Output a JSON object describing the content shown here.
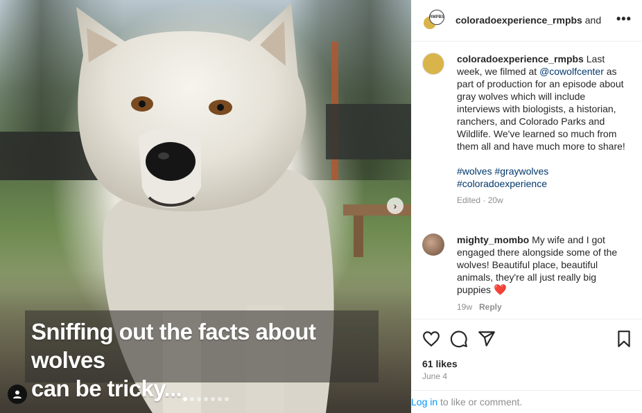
{
  "media": {
    "caption_line1": "Sniffing out the facts about wolves",
    "caption_line2": "can be tricky...",
    "next_icon": "chevron-right-icon",
    "carousel_dots": 7,
    "carousel_active_index": 0
  },
  "header": {
    "username": "coloradoexperience_rmpbs",
    "suffix": " and ",
    "avatar_badge": "RMPBS"
  },
  "post_caption": {
    "username": "coloradoexperience_rmpbs",
    "text_before_mention": " Last week, we filmed at ",
    "mention": "@cowolfcenter",
    "text_after_mention": " as part of production for an episode about gray wolves which will include interviews with biologists, a historian, ranchers, and Colorado Parks and Wildlife. We've learned so much from them all and have much more to share!",
    "hashtags": [
      "#wolves",
      "#graywolves",
      "#coloradoexperience"
    ],
    "meta": "Edited · 20w"
  },
  "comments": [
    {
      "username": "mighty_mombo",
      "text": " My wife and I got engaged there alongside some of the wolves! Beautiful place, beautiful animals, they're all just really big puppies ",
      "emoji": "❤️",
      "age": "19w",
      "reply_label": "Reply"
    }
  ],
  "actions": {
    "likes": "61 likes",
    "date": "June 4"
  },
  "login_bar": {
    "link": "Log in",
    "text": " to like or comment."
  },
  "colors": {
    "link": "#00376b",
    "login_link": "#0095f6",
    "muted": "#8e8e8e",
    "heart": "#ed1c24"
  }
}
